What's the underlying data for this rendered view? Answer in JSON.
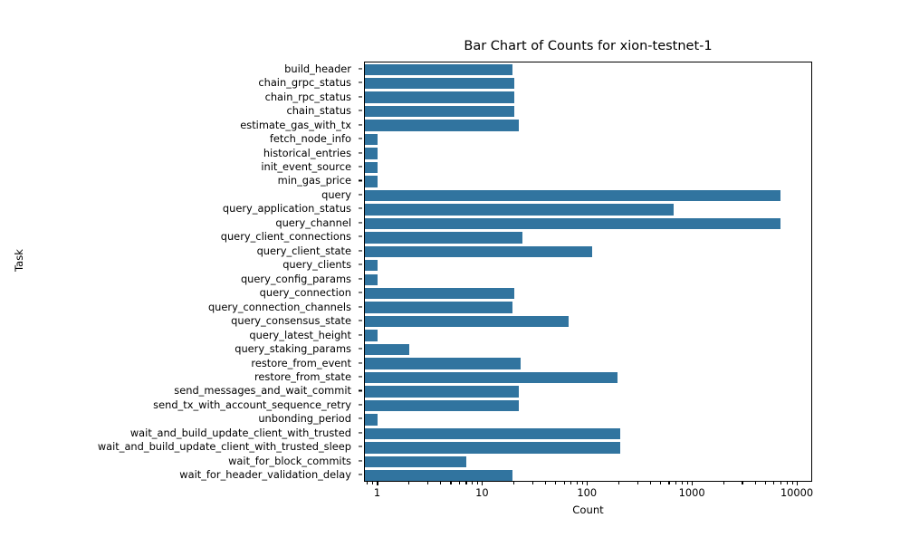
{
  "chart_data": {
    "type": "bar",
    "orientation": "horizontal",
    "title": "Bar Chart of Counts for xion-testnet-1",
    "xlabel": "Count",
    "ylabel": "Task",
    "xscale": "log",
    "xlim": [
      0.75,
      14000
    ],
    "grid": false,
    "legend": null,
    "bar_color": "#31749f",
    "xticks": [
      1,
      10,
      100,
      1000,
      10000
    ],
    "xtick_labels": [
      "1",
      "10",
      "100",
      "1000",
      "10000"
    ],
    "categories": [
      "build_header",
      "chain_grpc_status",
      "chain_rpc_status",
      "chain_status",
      "estimate_gas_with_tx",
      "fetch_node_info",
      "historical_entries",
      "init_event_source",
      "min_gas_price",
      "query",
      "query_application_status",
      "query_channel",
      "query_client_connections",
      "query_client_state",
      "query_clients",
      "query_config_params",
      "query_connection",
      "query_connection_channels",
      "query_consensus_state",
      "query_latest_height",
      "query_staking_params",
      "restore_from_event",
      "restore_from_state",
      "send_messages_and_wait_commit",
      "send_tx_with_account_sequence_retry",
      "unbonding_period",
      "wait_and_build_update_client_with_trusted",
      "wait_and_build_update_client_with_trusted_sleep",
      "wait_for_block_commits",
      "wait_for_header_validation_delay"
    ],
    "values": [
      19,
      20,
      20,
      20,
      22,
      1,
      1,
      1,
      1,
      6800,
      660,
      6800,
      24,
      110,
      1,
      1,
      20,
      19,
      65,
      1,
      2,
      23,
      190,
      22,
      22,
      1,
      205,
      205,
      7,
      19
    ]
  }
}
